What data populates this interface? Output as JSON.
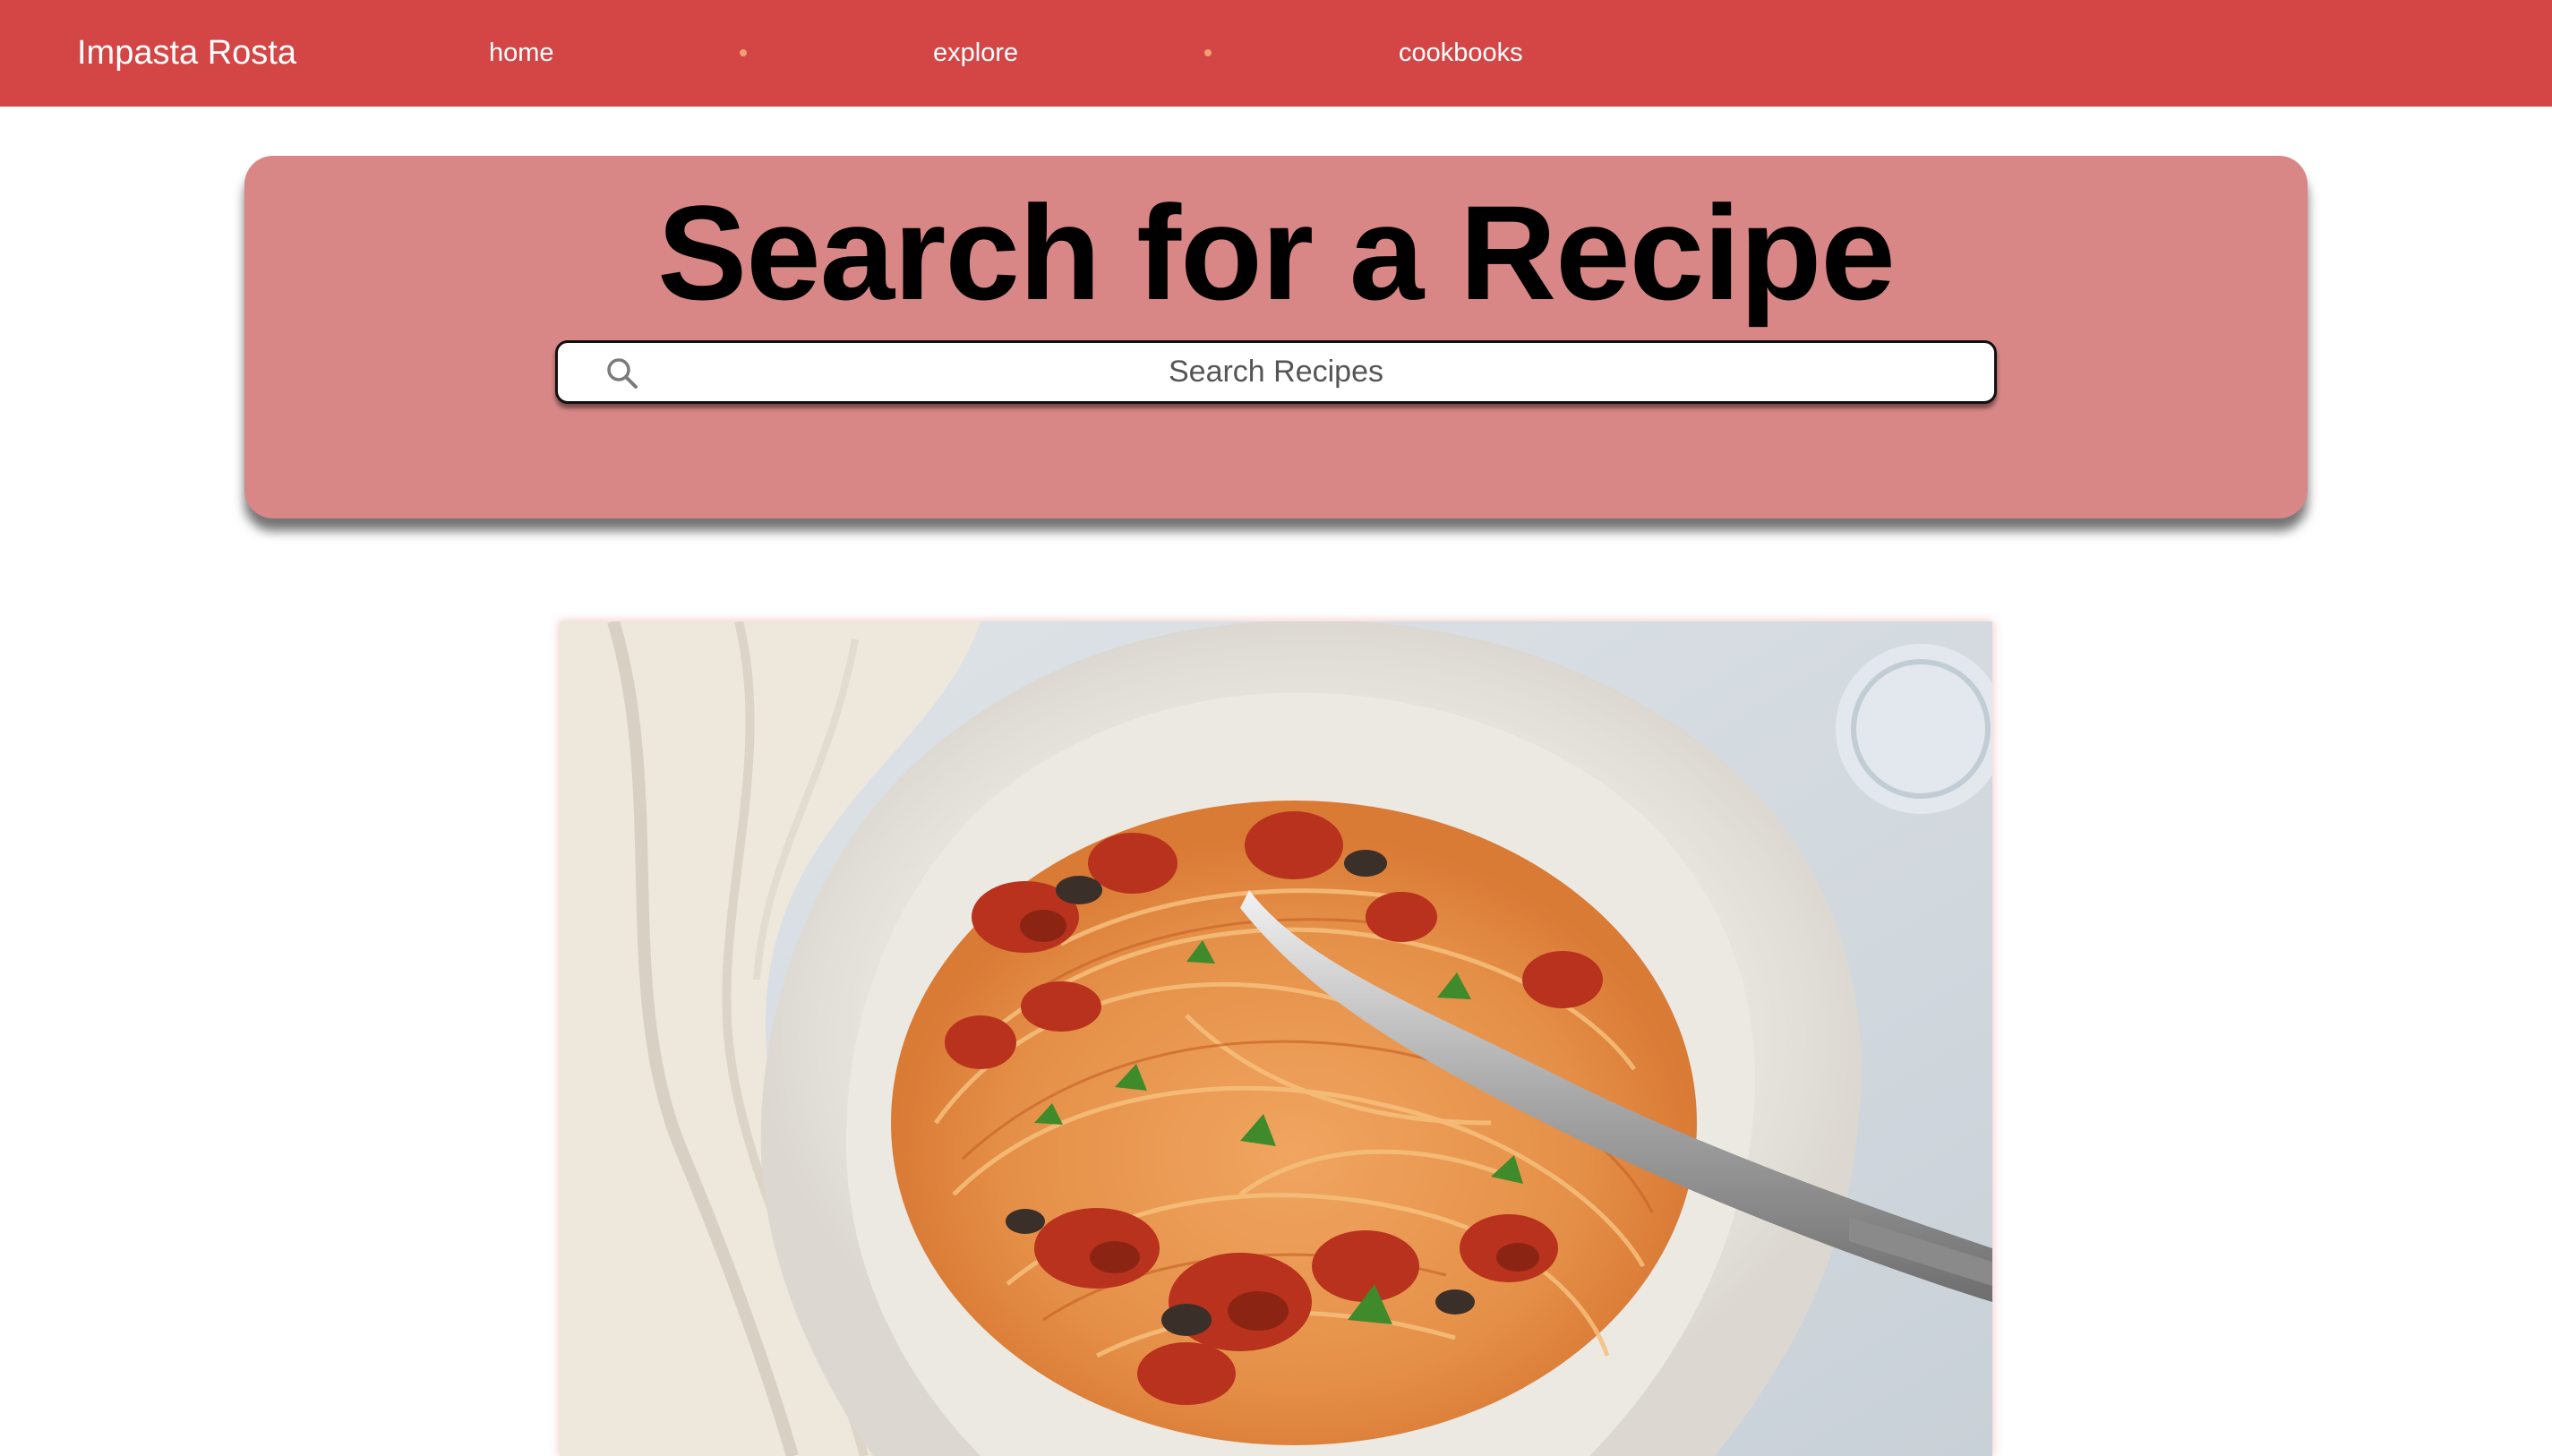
{
  "navbar": {
    "brand": "Impasta Rosta",
    "links": [
      {
        "label": "home"
      },
      {
        "label": "explore"
      },
      {
        "label": "cookbooks"
      }
    ],
    "background": "#d44545",
    "separator_color": "#f0a070"
  },
  "hero": {
    "title": "Search for a Recipe",
    "background": "#d98686",
    "search": {
      "placeholder": "Search Recipes",
      "value": "",
      "icon": "search-icon"
    }
  },
  "featured": {
    "image_subject": "plate of spaghetti with tomato sauce and a fork"
  }
}
